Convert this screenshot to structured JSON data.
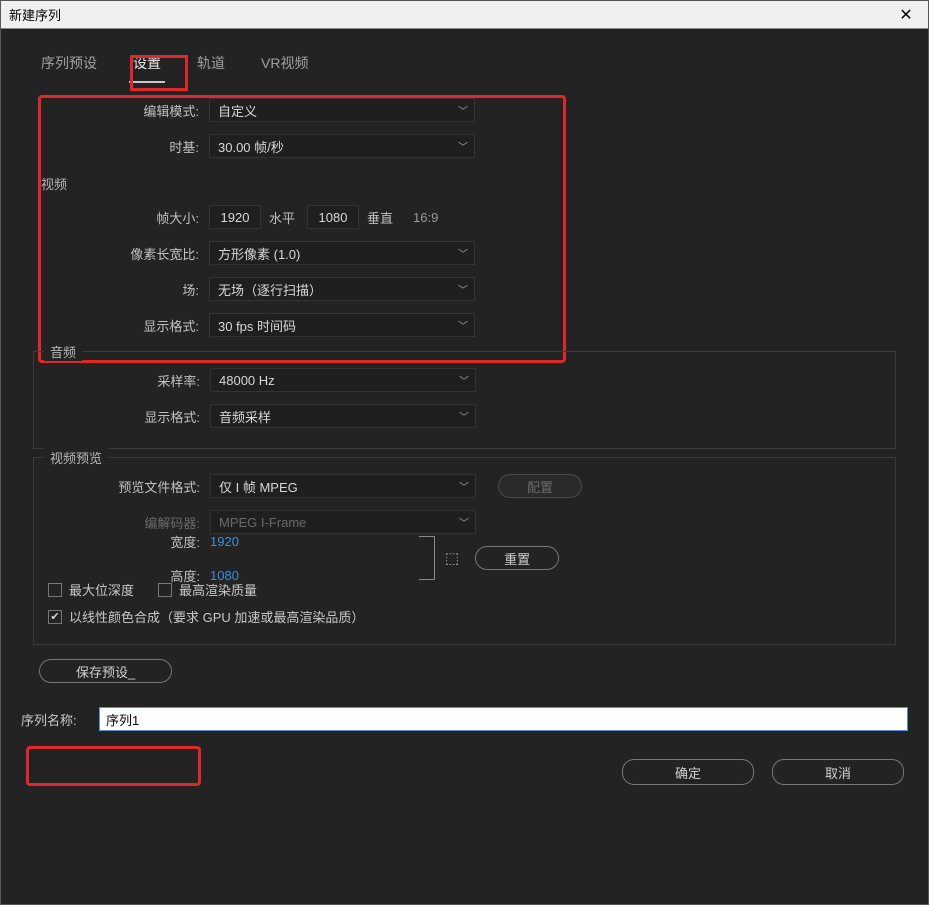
{
  "window": {
    "title": "新建序列"
  },
  "tabs": {
    "presets": "序列预设",
    "settings": "设置",
    "tracks": "轨道",
    "vr": "VR视频"
  },
  "labels": {
    "editMode": "编辑模式:",
    "timebase": "时基:",
    "videoSection": "视频",
    "frameSize": "帧大小:",
    "horiz": "水平",
    "vert": "垂直",
    "aspect": "16:9",
    "pixelAspect": "像素长宽比:",
    "fields": "场:",
    "displayFormatV": "显示格式:",
    "audioSection": "音频",
    "sampleRate": "采样率:",
    "displayFormatA": "显示格式:",
    "previewSection": "视频预览",
    "previewFormat": "预览文件格式:",
    "codec": "编解码器:",
    "width": "宽度:",
    "height": "高度:",
    "configure": "配置",
    "reset": "重置",
    "maxBitDepth": "最大位深度",
    "maxQuality": "最高渲染质量",
    "linearComposite": "以线性颜色合成（要求 GPU 加速或最高渲染品质）",
    "savePreset": "保存预设_",
    "seqName": "序列名称:",
    "ok": "确定",
    "cancel": "取消"
  },
  "values": {
    "editMode": "自定义",
    "timebase": "30.00 帧/秒",
    "frameW": "1920",
    "frameH": "1080",
    "pixelAspect": "方形像素 (1.0)",
    "fields": "无场（逐行扫描）",
    "displayFormatV": "30 fps 时间码",
    "sampleRate": "48000 Hz",
    "displayFormatA": "音频采样",
    "previewFormat": "仅 I 帧 MPEG",
    "codec": "MPEG I-Frame",
    "previewW": "1920",
    "previewH": "1080",
    "seqName": "序列1"
  },
  "checks": {
    "maxBitDepth": false,
    "maxQuality": false,
    "linearComposite": true
  }
}
